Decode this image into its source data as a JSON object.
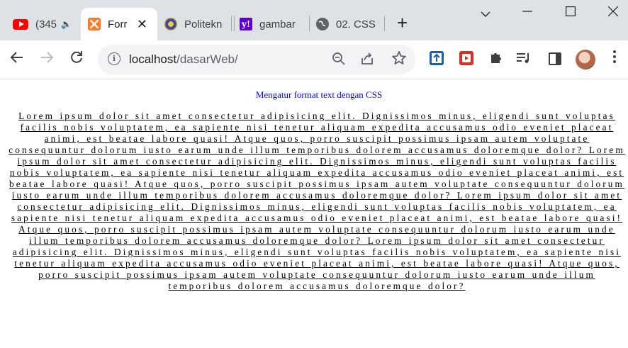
{
  "browser": {
    "tabs": [
      {
        "title": "(345",
        "favicon": "youtube-icon",
        "audio": true
      },
      {
        "title": "Forr",
        "favicon": "xampp-icon",
        "active": true
      },
      {
        "title": "Politekn",
        "favicon": "politeknik-logo-icon"
      },
      {
        "title": "gambar",
        "favicon": "yahoo-icon"
      },
      {
        "title": "02. CSS",
        "favicon": "globe-icon"
      }
    ],
    "toolbar": {
      "url_host": "localhost",
      "url_path": "/dasarWeb/"
    }
  },
  "page": {
    "heading": "Mengatur format text dengan CSS",
    "paragraph": "Lorem ipsum dolor sit amet consectetur adipisicing elit. Dignissimos minus, eligendi sunt voluptas facilis nobis voluptatem, ea sapiente nisi tenetur aliquam expedita accusamus odio eveniet placeat animi, est beatae labore quasi! Atque quos, porro suscipit possimus ipsam autem voluptate consequuntur dolorum iusto earum unde illum temporibus dolorem accusamus doloremque dolor? Lorem ipsum dolor sit amet consectetur adipisicing elit. Dignissimos minus, eligendi sunt voluptas facilis nobis voluptatem, ea sapiente nisi tenetur aliquam expedita accusamus odio eveniet placeat animi, est beatae labore quasi! Atque quos, porro suscipit possimus ipsam autem voluptate consequuntur dolorum iusto earum unde illum temporibus dolorem accusamus doloremque dolor? Lorem ipsum dolor sit amet consectetur adipisicing elit. Dignissimos minus, eligendi sunt voluptas facilis nobis voluptatem, ea sapiente nisi tenetur aliquam expedita accusamus odio eveniet placeat animi, est beatae labore quasi! Atque quos, porro suscipit possimus ipsam autem voluptate consequuntur dolorum iusto earum unde illum temporibus dolorem accusamus doloremque dolor? Lorem ipsum dolor sit amet consectetur adipisicing elit. Dignissimos minus, eligendi sunt voluptas facilis nobis voluptatem, ea sapiente nisi tenetur aliquam expedita accusamus odio eveniet placeat animi, est beatae labore quasi! Atque quos, porro suscipit possimus ipsam autem voluptate consequuntur dolorum iusto earum unde illum temporibus dolorem accusamus doloremque dolor?"
  },
  "colors": {
    "tabstrip": "#dee1e6",
    "heading": "#0000ff",
    "youtube": "#ff0000",
    "xampp": "#fb7a24",
    "yahoo": "#5f01d1"
  }
}
